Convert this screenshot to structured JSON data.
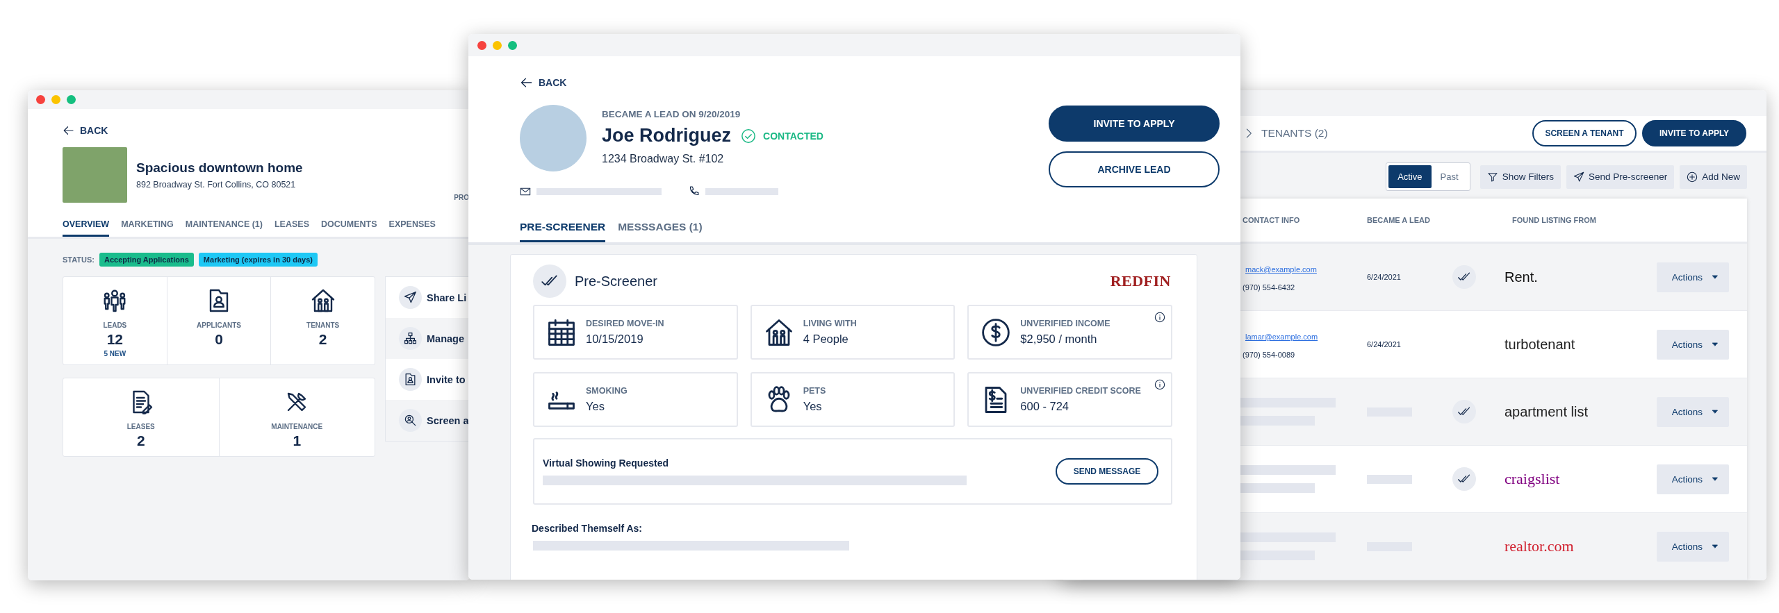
{
  "property_window": {
    "back": "BACK",
    "title": "Spacious downtown home",
    "address": "892 Broadway St. Fort Collins, CO 80521",
    "column_label": "PRO",
    "tabs": [
      {
        "label": "OVERVIEW",
        "selected": true
      },
      {
        "label": "MARKETING",
        "selected": false
      },
      {
        "label": "MAINTENANCE (1)",
        "selected": false
      },
      {
        "label": "LEASES",
        "selected": false
      },
      {
        "label": "DOCUMENTS",
        "selected": false
      },
      {
        "label": "EXPENSES",
        "selected": false
      }
    ],
    "status_label": "STATUS:",
    "status_tags": [
      {
        "text": "Accepting Applications",
        "color": "#1abc8c"
      },
      {
        "text": "Marketing (expires in 30 days)",
        "color": "#1ec8f5"
      }
    ],
    "stats_row_1": [
      {
        "label": "LEADS",
        "value": "12",
        "note": "5 NEW"
      },
      {
        "label": "APPLICANTS",
        "value": "0"
      },
      {
        "label": "TENANTS",
        "value": "2"
      }
    ],
    "stats_row_2": [
      {
        "label": "LEASES",
        "value": "2"
      },
      {
        "label": "MAINTENANCE",
        "value": "1"
      }
    ],
    "actions": [
      {
        "label": "Share Li",
        "selected": false
      },
      {
        "label": "Manage",
        "selected": true
      },
      {
        "label": "Invite to",
        "selected": false
      },
      {
        "label": "Screen a",
        "selected": true
      }
    ]
  },
  "lead_window": {
    "back": "BACK",
    "became_lead": "BECAME A LEAD ON 9/20/2019",
    "name": "Joe Rodriguez",
    "status": "CONTACTED",
    "address": "1234 Broadway St. #102",
    "buttons": [
      {
        "label": "INVITE TO APPLY",
        "kind": "primary"
      },
      {
        "label": "ARCHIVE LEAD",
        "kind": "outline"
      }
    ],
    "tabs": [
      {
        "label": "PRE-SCREENER",
        "selected": true
      },
      {
        "label": "MESSSAGES (1)",
        "selected": false
      }
    ],
    "prescreener": {
      "title": "Pre-Screener",
      "source": "REDFIN",
      "facts": [
        {
          "label": "DESIRED MOVE-IN",
          "value": "10/15/2019",
          "info": false
        },
        {
          "label": "LIVING WITH",
          "value": "4 People",
          "info": false
        },
        {
          "label": "UNVERIFIED INCOME",
          "value": "$2,950 / month",
          "info": true
        },
        {
          "label": "SMOKING",
          "value": "Yes",
          "info": false
        },
        {
          "label": "PETS",
          "value": "Yes",
          "info": false
        },
        {
          "label": "UNVERIFIED CREDIT SCORE",
          "value": "600 - 724",
          "info": true
        }
      ],
      "request": {
        "title": "Virtual Showing Requested",
        "button": "SEND MESSAGE"
      },
      "described_label": "Described Themself As:"
    }
  },
  "leads_window": {
    "breadcrumb": "TENANTS (2)",
    "buttons": [
      {
        "label": "SCREEN A TENANT",
        "kind": "outline"
      },
      {
        "label": "INVITE TO APPLY",
        "kind": "primary"
      }
    ],
    "view_toggle": [
      {
        "label": "Active",
        "selected": true
      },
      {
        "label": "Past",
        "selected": false
      }
    ],
    "tools": [
      "Show Filters",
      "Send Pre-screener",
      "Add New"
    ],
    "table": {
      "columns": [
        "CONTACT INFO",
        "BECAME A LEAD",
        "FOUND LISTING FROM"
      ],
      "rows": [
        {
          "email": "mack@example.com",
          "phone": "(970) 554-6432",
          "became_lead": "6/24/2021",
          "prescreened": true,
          "source": "Rent.",
          "color": "#111111",
          "action": "Actions"
        },
        {
          "email": "lamar@example.com",
          "phone": "(970) 554-0089",
          "became_lead": "6/24/2021",
          "prescreened": false,
          "source": "turbotenant",
          "color": "#1f1f1f",
          "action": "Actions"
        },
        {
          "prescreened": true,
          "source": "apartment list",
          "color": "#222222",
          "action": "Actions"
        },
        {
          "prescreened": true,
          "source": "craigslist",
          "color": "#800080",
          "action": "Actions"
        },
        {
          "prescreened": false,
          "source": "realtor.com",
          "color": "#d1202f",
          "action": "Actions"
        }
      ]
    }
  }
}
